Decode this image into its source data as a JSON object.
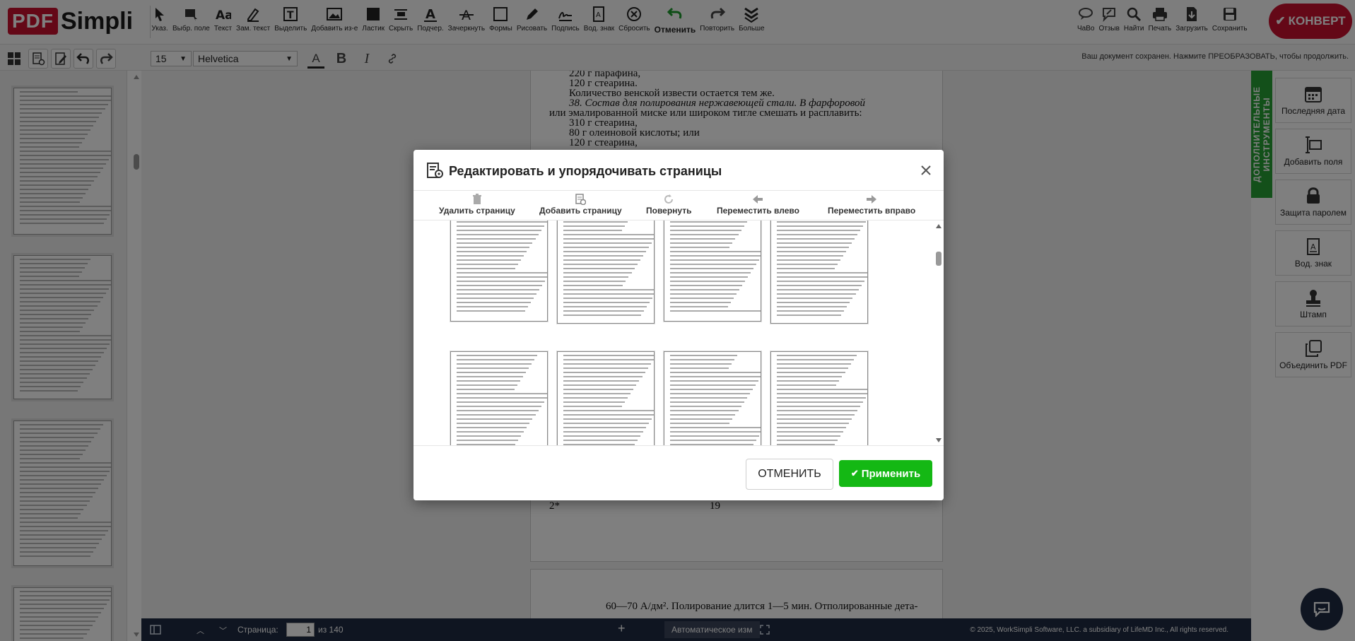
{
  "logo": {
    "part1": "PDF",
    "part2": "Simpli"
  },
  "toolbar": {
    "tools_left": [
      {
        "label": "Указ.",
        "icon": "cursor-icon"
      },
      {
        "label": "Выбр. поле",
        "icon": "select-field-icon"
      },
      {
        "label": "Текст",
        "icon": "text-icon"
      },
      {
        "label": "Зам. текст",
        "icon": "replace-text-icon"
      },
      {
        "label": "Выделить",
        "icon": "highlight-icon"
      },
      {
        "label": "Добавить из-е",
        "icon": "add-image-icon"
      },
      {
        "label": "Ластик",
        "icon": "eraser-icon"
      },
      {
        "label": "Скрыть",
        "icon": "hide-icon"
      },
      {
        "label": "Подчер.",
        "icon": "underline-icon"
      },
      {
        "label": "Зачеркнуть",
        "icon": "strikethrough-icon"
      },
      {
        "label": "Формы",
        "icon": "shapes-icon"
      },
      {
        "label": "Рисовать",
        "icon": "draw-icon"
      },
      {
        "label": "Подпись",
        "icon": "signature-icon"
      },
      {
        "label": "Вод. знак",
        "icon": "watermark-icon"
      },
      {
        "label": "Сбросить",
        "icon": "reset-icon"
      },
      {
        "label": "Отменить",
        "icon": "undo-icon"
      },
      {
        "label": "Повторить",
        "icon": "redo-icon"
      },
      {
        "label": "Больше",
        "icon": "more-icon"
      }
    ],
    "tools_right": [
      {
        "label": "ЧаВо",
        "icon": "faq-icon"
      },
      {
        "label": "Отзыв",
        "icon": "feedback-icon"
      },
      {
        "label": "Найти",
        "icon": "search-icon"
      },
      {
        "label": "Печать",
        "icon": "print-icon"
      },
      {
        "label": "Загрузить",
        "icon": "download-icon"
      },
      {
        "label": "Сохранить",
        "icon": "save-icon"
      }
    ],
    "convert_label": "КОНВЕРТ"
  },
  "subbar": {
    "font_size": "15",
    "font_family": "Helvetica",
    "bold_label": "B",
    "italic_label": "I",
    "color_label": "A",
    "saved_message": "Ваш документ сохранен. Нажмите ПРЕОБРАЗОВАТЬ, чтобы продолжить."
  },
  "document": {
    "page_lines": [
      "220 г парафина,",
      "120 г стеарина.",
      "Количество венской извести остается тем же.",
      "38. Состав для полирования нержавеющей стали. В фарфоровой",
      "или эмалированной миске или широком тигле смешать и расплавить:",
      "310 г стеарина,",
      "80 г олеиновой кислоты; или",
      "120 г стеарина,"
    ],
    "page_footer_left": "2*",
    "page_footer_number": "19",
    "next_page_line": "60—70 А/дм². Полирование длится 1—5 мин. Отполированные дета-"
  },
  "right_panel": {
    "tab_label": "ДОПОЛНИТЕЛЬНЫЕ ИНСТРУМЕНТЫ",
    "tools": [
      {
        "label": "Последняя дата",
        "icon": "calendar-icon"
      },
      {
        "label": "Добавить поля",
        "icon": "text-field-icon"
      },
      {
        "label": "Защита паролем",
        "icon": "lock-icon"
      },
      {
        "label": "Вод. знак",
        "icon": "watermark-icon"
      },
      {
        "label": "Штамп",
        "icon": "stamp-icon"
      },
      {
        "label": "Объединить PDF",
        "icon": "merge-icon"
      }
    ]
  },
  "bottombar": {
    "page_label": "Страница:",
    "page_current": "1",
    "page_total": "из 140",
    "auto_label": "Автоматическое изм",
    "copyright": "© 2025, WorkSimpli Software, LLC. a subsidiary of LifeMD Inc., All rights reserved."
  },
  "modal": {
    "title": "Редактировать и упорядочивать страницы",
    "actions": [
      {
        "label": "Удалить страницу",
        "icon": "trash-icon"
      },
      {
        "label": "Добавить страницу",
        "icon": "add-page-icon"
      },
      {
        "label": "Повернуть",
        "icon": "rotate-icon"
      },
      {
        "label": "Переместить влево",
        "icon": "arrow-left-icon"
      },
      {
        "label": "Переместить вправо",
        "icon": "arrow-right-icon"
      }
    ],
    "cancel_label": "ОТМЕНИТЬ",
    "apply_label": "Применить"
  },
  "colors": {
    "brand_red": "#c8102e",
    "accent_green": "#14b814",
    "panel_green": "#26a135",
    "navy": "#1f2b43"
  }
}
